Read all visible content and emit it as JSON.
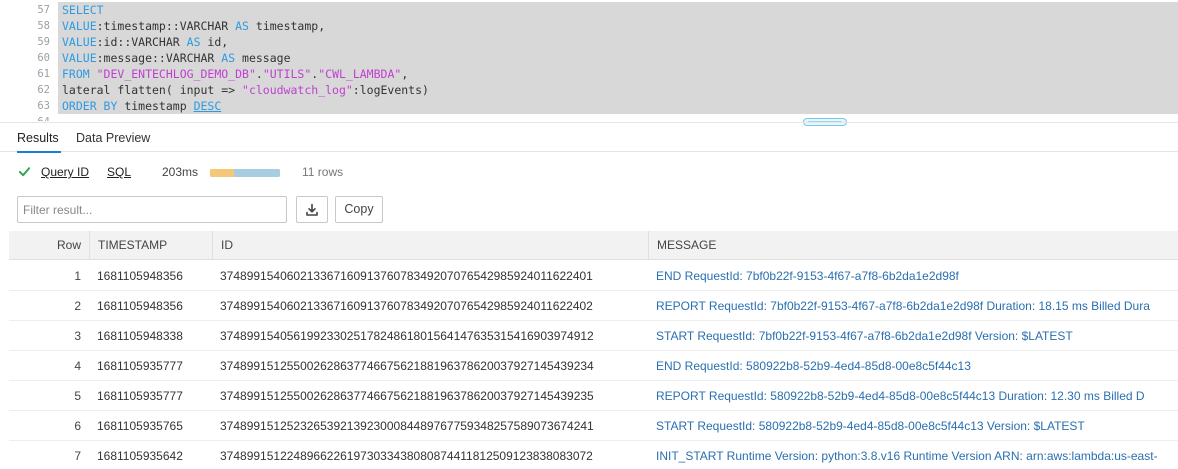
{
  "editor": {
    "lines": [
      {
        "num": "57",
        "tokens": [
          {
            "t": "SELECT",
            "c": "kw"
          }
        ]
      },
      {
        "num": "58",
        "tokens": [
          {
            "t": "VALUE",
            "c": "kw"
          },
          {
            "t": ":timestamp::VARCHAR ",
            "c": "plain"
          },
          {
            "t": "AS",
            "c": "kw"
          },
          {
            "t": " timestamp,",
            "c": "plain"
          }
        ]
      },
      {
        "num": "59",
        "tokens": [
          {
            "t": "VALUE",
            "c": "kw"
          },
          {
            "t": ":id::VARCHAR ",
            "c": "plain"
          },
          {
            "t": "AS",
            "c": "kw"
          },
          {
            "t": " id,",
            "c": "plain"
          }
        ]
      },
      {
        "num": "60",
        "tokens": [
          {
            "t": "VALUE",
            "c": "kw"
          },
          {
            "t": ":message::VARCHAR ",
            "c": "plain"
          },
          {
            "t": "AS",
            "c": "kw"
          },
          {
            "t": " message",
            "c": "plain"
          }
        ]
      },
      {
        "num": "61",
        "tokens": [
          {
            "t": "FROM ",
            "c": "kw"
          },
          {
            "t": "\"DEV_ENTECHLOG_DEMO_DB\"",
            "c": "str"
          },
          {
            "t": ".",
            "c": "plain"
          },
          {
            "t": "\"UTILS\"",
            "c": "str"
          },
          {
            "t": ".",
            "c": "plain"
          },
          {
            "t": "\"CWL_LAMBDA\"",
            "c": "str"
          },
          {
            "t": ",",
            "c": "plain"
          }
        ]
      },
      {
        "num": "62",
        "tokens": [
          {
            "t": "lateral flatten( input => ",
            "c": "plain"
          },
          {
            "t": "\"cloudwatch_log\"",
            "c": "str"
          },
          {
            "t": ":logEvents)",
            "c": "plain"
          }
        ]
      },
      {
        "num": "63",
        "tokens": [
          {
            "t": "ORDER BY ",
            "c": "kw"
          },
          {
            "t": "timestamp ",
            "c": "plain"
          },
          {
            "t": "DESC",
            "c": "kw cursor-u"
          }
        ]
      },
      {
        "num": "64",
        "tokens": []
      }
    ]
  },
  "tabs": [
    {
      "label": "Results",
      "active": true
    },
    {
      "label": "Data Preview",
      "active": false
    }
  ],
  "query_info": {
    "query_id_label": "Query ID",
    "sql_label": "SQL",
    "duration": "203ms",
    "rows": "11 rows",
    "status_color": "#3aa655"
  },
  "toolbar": {
    "filter_placeholder": "Filter result...",
    "copy_label": "Copy"
  },
  "table": {
    "columns": [
      "Row",
      "TIMESTAMP",
      "ID",
      "MESSAGE"
    ],
    "rows": [
      [
        "1",
        "1681105948356",
        "37489915406021336716091376078349207076542985924011622401",
        "END RequestId: 7bf0b22f-9153-4f67-a7f8-6b2da1e2d98f"
      ],
      [
        "2",
        "1681105948356",
        "37489915406021336716091376078349207076542985924011622402",
        "REPORT RequestId: 7bf0b22f-9153-4f67-a7f8-6b2da1e2d98f Duration: 18.15 ms Billed Dura"
      ],
      [
        "3",
        "1681105948338",
        "37489915405619923302517824861801564147635315416903974912",
        "START RequestId: 7bf0b22f-9153-4f67-a7f8-6b2da1e2d98f Version: $LATEST"
      ],
      [
        "4",
        "1681105935777",
        "37489915125500262863774667562188196378620037927145439234",
        "END RequestId: 580922b8-52b9-4ed4-85d8-00e8c5f44c13"
      ],
      [
        "5",
        "1681105935777",
        "37489915125500262863774667562188196378620037927145439235",
        "REPORT RequestId: 580922b8-52b9-4ed4-85d8-00e8c5f44c13 Duration: 12.30 ms Billed D"
      ],
      [
        "6",
        "1681105935765",
        "37489915125232653921392300084489767759348257589073674241",
        "START RequestId: 580922b8-52b9-4ed4-85d8-00e8c5f44c13 Version: $LATEST"
      ],
      [
        "7",
        "1681105935642",
        "37489915122489662261973033438080874411812509123838083072",
        "INIT_START Runtime Version: python:3.8.v16 Runtime Version ARN: arn:aws:lambda:us-east-"
      ]
    ]
  }
}
